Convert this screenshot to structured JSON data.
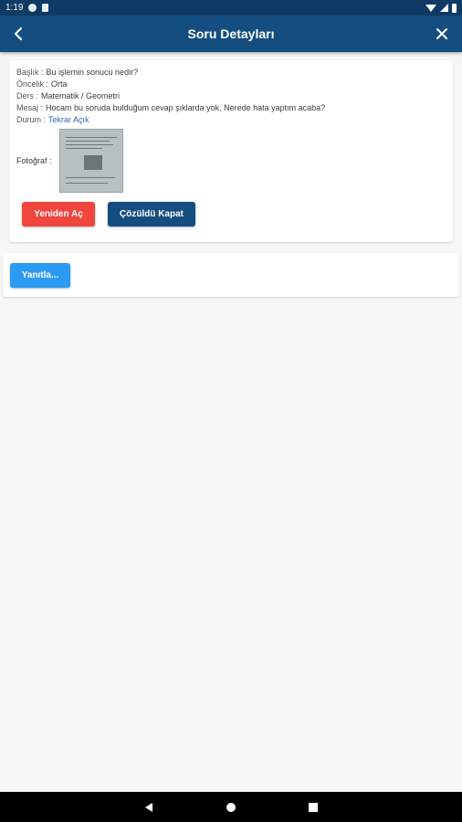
{
  "status_bar": {
    "time": "1:19",
    "icons": [
      "notification-icon",
      "sim-icon",
      "wifi-icon",
      "signal-icon",
      "battery-icon"
    ]
  },
  "app_bar": {
    "title": "Soru Detayları"
  },
  "details": {
    "rows": [
      {
        "label": "Başlık :",
        "value": "Bu işlemin sonucu nedir?"
      },
      {
        "label": "Öncelik :",
        "value": "Orta"
      },
      {
        "label": "Ders :",
        "value": "Matematik / Geometri"
      },
      {
        "label": "Mesaj :",
        "value": "Hocam bu soruda bulduğum cevap şıklarda yok. Nerede hata yaptım acaba?"
      },
      {
        "label": "Durum :",
        "value": "Tekrar Açık"
      }
    ],
    "photo_label": "Fotoğraf :"
  },
  "actions": {
    "reopen_label": "Yeniden Aç",
    "solved_close_label": "Çözüldü Kapat"
  },
  "reply": {
    "button_label": "Yanıtla..."
  },
  "colors": {
    "app_bar": "#144d80",
    "status_bar": "#0e3a63",
    "reopen": "#f1463d",
    "solved_close": "#144d80",
    "reply": "#2b9af3",
    "status_link": "#2e66b5"
  }
}
